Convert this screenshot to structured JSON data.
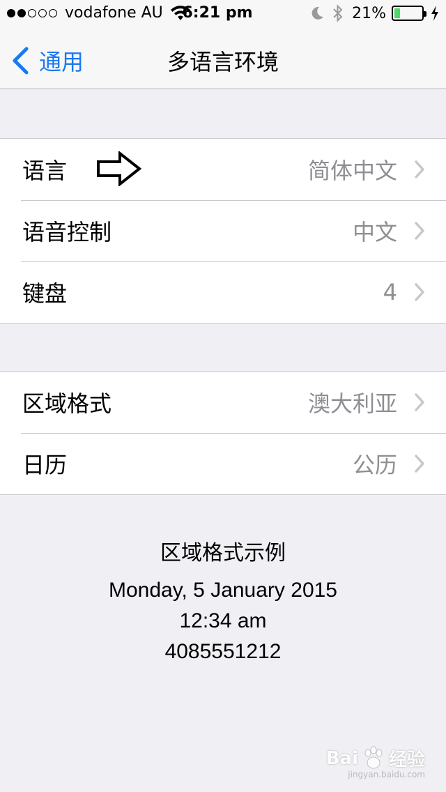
{
  "status_bar": {
    "signal_dots_filled": 2,
    "signal_dots_total": 5,
    "carrier": "vodafone AU",
    "time": "6:21 pm",
    "battery_pct": "21%",
    "battery_level": 0.21,
    "icons": [
      "wifi-icon",
      "moon-icon",
      "bluetooth-icon",
      "battery-icon",
      "charging-bolt-icon"
    ]
  },
  "nav": {
    "back_label": "通用",
    "title": "多语言环境"
  },
  "group1": [
    {
      "label": "语言",
      "value": "简体中文"
    },
    {
      "label": "语音控制",
      "value": "中文"
    },
    {
      "label": "键盘",
      "value": "4"
    }
  ],
  "group2": [
    {
      "label": "区域格式",
      "value": "澳大利亚"
    },
    {
      "label": "日历",
      "value": "公历"
    }
  ],
  "example": {
    "title": "区域格式示例",
    "date": "Monday, 5 January 2015",
    "time": "12:34 am",
    "phone": "4085551212"
  },
  "watermark": {
    "brand": "Bai",
    "brand_cn": "经验",
    "sub": "jingyan.baidu.com"
  },
  "colors": {
    "accent": "#1a78f2",
    "battery": "#4cd964",
    "value_gray": "#8e8e93",
    "background": "#efeff4"
  }
}
